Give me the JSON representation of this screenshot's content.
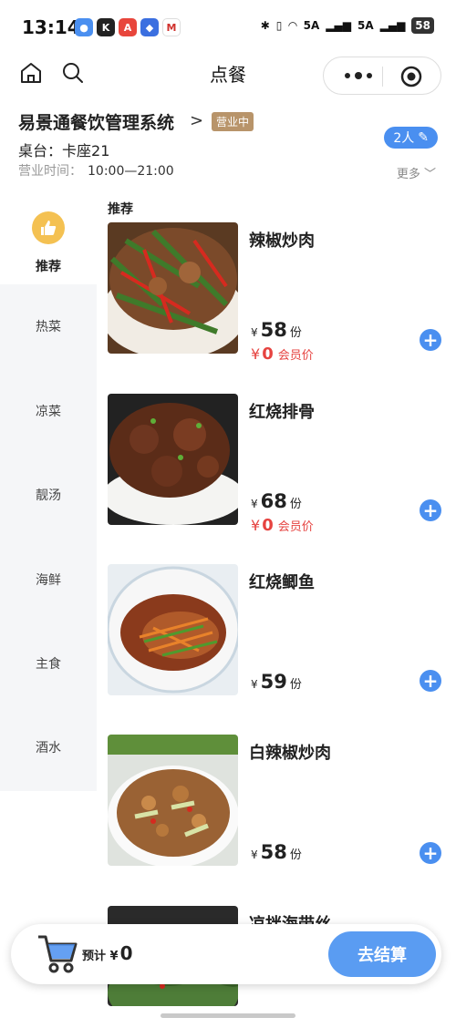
{
  "status_bar": {
    "time": "13:14",
    "network_1": "5A",
    "network_2": "5A",
    "battery": "58"
  },
  "nav": {
    "title": "点餐"
  },
  "store": {
    "name": "易景通餐饮管理系统",
    "chevron": ">",
    "status_badge": "营业中",
    "table_label": "桌台：",
    "table_value": "卡座21",
    "hours_label": "营业时间：",
    "hours_value": "10:00—21:00",
    "people": "2人",
    "more_label": "更多"
  },
  "sidebar": {
    "active": "推荐",
    "items": [
      "热菜",
      "凉菜",
      "靓汤",
      "海鲜",
      "主食",
      "酒水"
    ]
  },
  "menu": {
    "section_title": "推荐",
    "currency": "¥",
    "unit": "份",
    "member_label": "会员价",
    "dishes": [
      {
        "name": "辣椒炒肉",
        "price": "58",
        "member_price": "0"
      },
      {
        "name": "红烧排骨",
        "price": "68",
        "member_price": "0"
      },
      {
        "name": "红烧鲫鱼",
        "price": "59"
      },
      {
        "name": "白辣椒炒肉",
        "price": "58"
      },
      {
        "name": "凉拌海带丝"
      }
    ]
  },
  "cart": {
    "total_label": "预计",
    "currency": "¥",
    "total": "0",
    "checkout_label": "去结算"
  },
  "colors": {
    "accent_blue": "#4a8ff0",
    "member_red": "#e64340",
    "badge_brown": "#b8946a",
    "recommend_yellow": "#f4c152"
  }
}
